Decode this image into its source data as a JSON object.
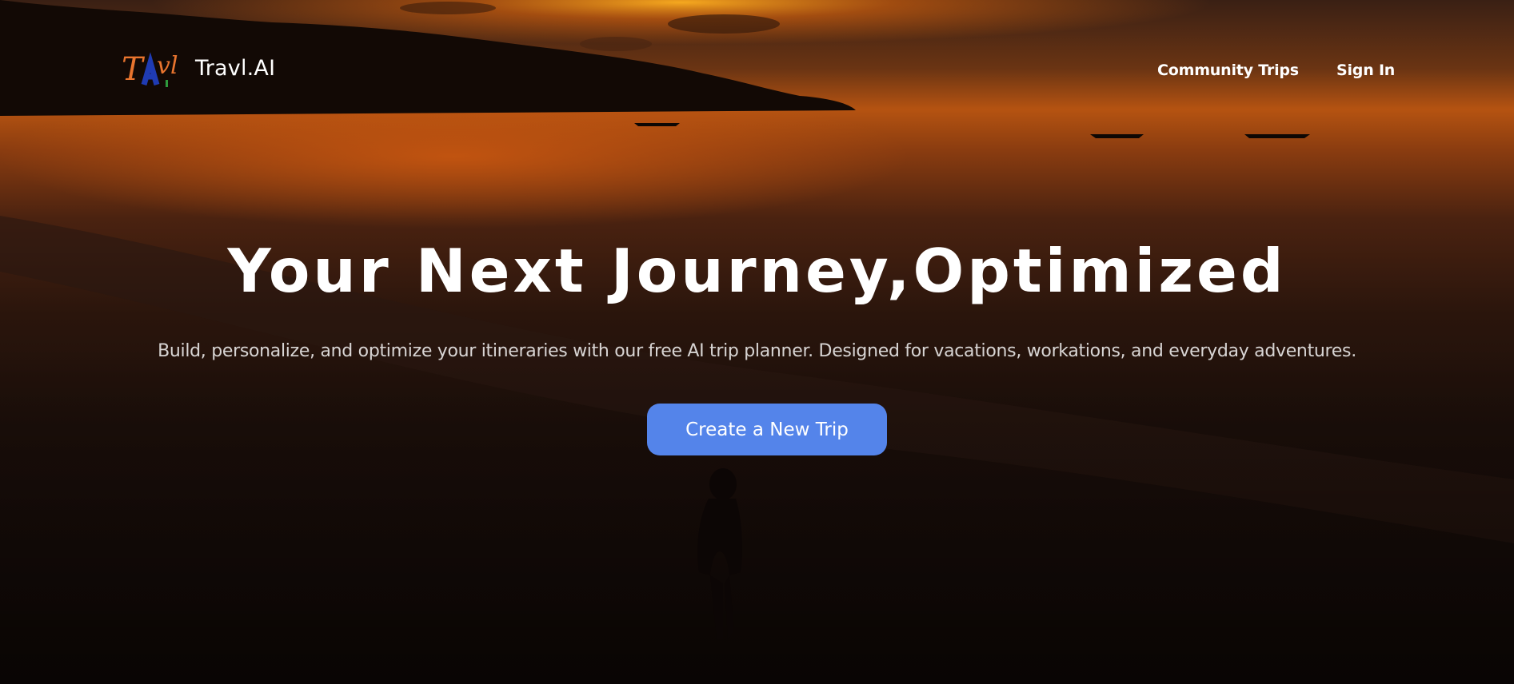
{
  "nav": {
    "brand": "Travl.AI",
    "logo_text": "Travl",
    "links": [
      "Community Trips",
      "Sign In"
    ]
  },
  "hero": {
    "headline": "Your Next Journey,Optimized",
    "subheadline": "Build, personalize, and optimize your itineraries with our free AI trip planner. Designed for vacations, workations, and everyday adventures.",
    "cta_label": "Create a New Trip"
  },
  "colors": {
    "cta": "#5484ea",
    "logo_orange": "#e8742e",
    "logo_blue": "#1f3bb3",
    "logo_green": "#2e9a3c"
  }
}
